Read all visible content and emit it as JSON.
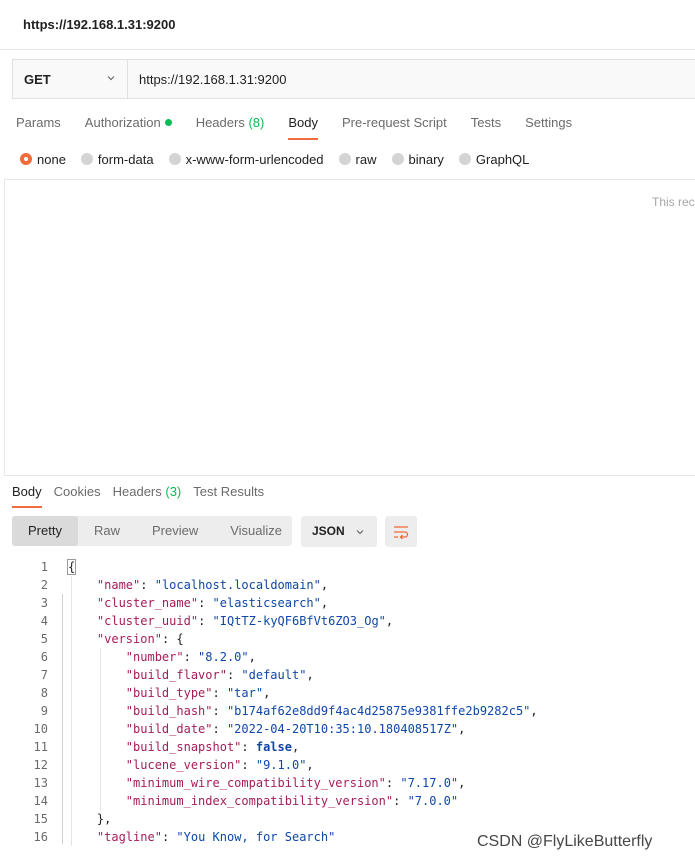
{
  "window": {
    "title": "https://192.168.1.31:9200"
  },
  "request": {
    "method": "GET",
    "url": "https://192.168.1.31:9200"
  },
  "request_tabs": [
    {
      "label": "Params"
    },
    {
      "label": "Authorization"
    },
    {
      "label": "Headers",
      "count": "(8)"
    },
    {
      "label": "Body"
    },
    {
      "label": "Pre-request Script"
    },
    {
      "label": "Tests"
    },
    {
      "label": "Settings"
    }
  ],
  "body_options": [
    "none",
    "form-data",
    "x-www-form-urlencoded",
    "raw",
    "binary",
    "GraphQL"
  ],
  "body_note": "This rec",
  "response_tabs": [
    {
      "label": "Body"
    },
    {
      "label": "Cookies"
    },
    {
      "label": "Headers",
      "count": "(3)"
    },
    {
      "label": "Test Results"
    }
  ],
  "view_modes": [
    "Pretty",
    "Raw",
    "Preview",
    "Visualize"
  ],
  "format": "JSON",
  "code_lines": [
    {
      "n": "1",
      "tokens": [
        [
          "p",
          "{"
        ]
      ]
    },
    {
      "n": "2",
      "tokens": [
        [
          "p",
          "    "
        ],
        [
          "k",
          "\"name\""
        ],
        [
          "p",
          ": "
        ],
        [
          "s",
          "\"localhost.localdomain\""
        ],
        [
          "p",
          ","
        ]
      ]
    },
    {
      "n": "3",
      "tokens": [
        [
          "p",
          "    "
        ],
        [
          "k",
          "\"cluster_name\""
        ],
        [
          "p",
          ": "
        ],
        [
          "s",
          "\"elasticsearch\""
        ],
        [
          "p",
          ","
        ]
      ]
    },
    {
      "n": "4",
      "tokens": [
        [
          "p",
          "    "
        ],
        [
          "k",
          "\"cluster_uuid\""
        ],
        [
          "p",
          ": "
        ],
        [
          "s",
          "\"IQtTZ-kyQF6BfVt6ZO3_Og\""
        ],
        [
          "p",
          ","
        ]
      ]
    },
    {
      "n": "5",
      "tokens": [
        [
          "p",
          "    "
        ],
        [
          "k",
          "\"version\""
        ],
        [
          "p",
          ": {"
        ]
      ]
    },
    {
      "n": "6",
      "tokens": [
        [
          "p",
          "        "
        ],
        [
          "k",
          "\"number\""
        ],
        [
          "p",
          ": "
        ],
        [
          "s",
          "\"8.2.0\""
        ],
        [
          "p",
          ","
        ]
      ]
    },
    {
      "n": "7",
      "tokens": [
        [
          "p",
          "        "
        ],
        [
          "k",
          "\"build_flavor\""
        ],
        [
          "p",
          ": "
        ],
        [
          "s",
          "\"default\""
        ],
        [
          "p",
          ","
        ]
      ]
    },
    {
      "n": "8",
      "tokens": [
        [
          "p",
          "        "
        ],
        [
          "k",
          "\"build_type\""
        ],
        [
          "p",
          ": "
        ],
        [
          "s",
          "\"tar\""
        ],
        [
          "p",
          ","
        ]
      ]
    },
    {
      "n": "9",
      "tokens": [
        [
          "p",
          "        "
        ],
        [
          "k",
          "\"build_hash\""
        ],
        [
          "p",
          ": "
        ],
        [
          "s",
          "\"b174af62e8dd9f4ac4d25875e9381ffe2b9282c5\""
        ],
        [
          "p",
          ","
        ]
      ]
    },
    {
      "n": "10",
      "tokens": [
        [
          "p",
          "        "
        ],
        [
          "k",
          "\"build_date\""
        ],
        [
          "p",
          ": "
        ],
        [
          "s",
          "\"2022-04-20T10:35:10.180408517Z\""
        ],
        [
          "p",
          ","
        ]
      ]
    },
    {
      "n": "11",
      "tokens": [
        [
          "p",
          "        "
        ],
        [
          "k",
          "\"build_snapshot\""
        ],
        [
          "p",
          ": "
        ],
        [
          "b",
          "false"
        ],
        [
          "p",
          ","
        ]
      ]
    },
    {
      "n": "12",
      "tokens": [
        [
          "p",
          "        "
        ],
        [
          "k",
          "\"lucene_version\""
        ],
        [
          "p",
          ": "
        ],
        [
          "s",
          "\"9.1.0\""
        ],
        [
          "p",
          ","
        ]
      ]
    },
    {
      "n": "13",
      "tokens": [
        [
          "p",
          "        "
        ],
        [
          "k",
          "\"minimum_wire_compatibility_version\""
        ],
        [
          "p",
          ": "
        ],
        [
          "s",
          "\"7.17.0\""
        ],
        [
          "p",
          ","
        ]
      ]
    },
    {
      "n": "14",
      "tokens": [
        [
          "p",
          "        "
        ],
        [
          "k",
          "\"minimum_index_compatibility_version\""
        ],
        [
          "p",
          ": "
        ],
        [
          "s",
          "\"7.0.0\""
        ]
      ]
    },
    {
      "n": "15",
      "tokens": [
        [
          "p",
          "    },"
        ]
      ]
    },
    {
      "n": "16",
      "tokens": [
        [
          "p",
          "    "
        ],
        [
          "k",
          "\"tagline\""
        ],
        [
          "p",
          ": "
        ],
        [
          "s",
          "\"You Know, for Search\""
        ]
      ]
    }
  ],
  "watermark": "CSDN @FlyLikeButterfly",
  "colors": {
    "accent": "#f26b3a",
    "green": "#0cbb52",
    "key": "#a41e5a",
    "string": "#0f47a8"
  },
  "icons": [
    "chevron-down-icon",
    "status-dot-icon",
    "radio-icon",
    "word-wrap-icon"
  ]
}
